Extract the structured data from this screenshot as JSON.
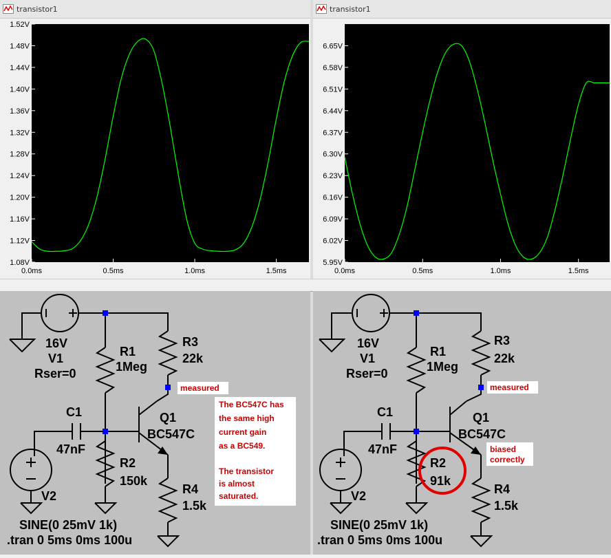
{
  "plots": [
    {
      "window_title": "transistor1",
      "chart_data": {
        "type": "line",
        "x": [
          0.0,
          0.05,
          0.1,
          0.15,
          0.2,
          0.25,
          0.3,
          0.35,
          0.4,
          0.45,
          0.5,
          0.55,
          0.6,
          0.65,
          0.7,
          0.75,
          0.8,
          0.85,
          0.9,
          0.95,
          1.0,
          1.05,
          1.1,
          1.15,
          1.2,
          1.25,
          1.3,
          1.35,
          1.4,
          1.45,
          1.5,
          1.55,
          1.6,
          1.65,
          1.7
        ],
        "y": [
          1.118,
          1.104,
          1.1,
          1.1,
          1.101,
          1.105,
          1.12,
          1.15,
          1.2,
          1.27,
          1.35,
          1.42,
          1.465,
          1.488,
          1.492,
          1.47,
          1.41,
          1.33,
          1.24,
          1.16,
          1.115,
          1.104,
          1.101,
          1.1,
          1.1,
          1.103,
          1.115,
          1.145,
          1.195,
          1.265,
          1.345,
          1.415,
          1.462,
          1.486,
          1.488
        ],
        "xlim": [
          0.0,
          1.7
        ],
        "ylim": [
          1.08,
          1.52
        ],
        "grid": false,
        "yticks": [
          "1.08V",
          "1.12V",
          "1.16V",
          "1.20V",
          "1.24V",
          "1.28V",
          "1.32V",
          "1.36V",
          "1.40V",
          "1.44V",
          "1.48V",
          "1.52V"
        ],
        "xticks": [
          "0.0ms",
          "0.5ms",
          "1.0ms",
          "1.5ms"
        ],
        "trace_color": "#00ff00"
      }
    },
    {
      "window_title": "transistor1",
      "chart_data": {
        "type": "line",
        "x": [
          0.0,
          0.05,
          0.1,
          0.15,
          0.2,
          0.25,
          0.3,
          0.35,
          0.4,
          0.45,
          0.5,
          0.55,
          0.6,
          0.65,
          0.7,
          0.75,
          0.8,
          0.85,
          0.9,
          0.95,
          1.0,
          1.05,
          1.1,
          1.15,
          1.2,
          1.25,
          1.3,
          1.35,
          1.4,
          1.45,
          1.5,
          1.55,
          1.6,
          1.65,
          1.7
        ],
        "y": [
          6.29,
          6.17,
          6.07,
          6.0,
          5.965,
          5.96,
          5.98,
          6.04,
          6.13,
          6.25,
          6.37,
          6.48,
          6.57,
          6.63,
          6.655,
          6.65,
          6.6,
          6.51,
          6.4,
          6.28,
          6.17,
          6.07,
          6.0,
          5.965,
          5.96,
          5.98,
          6.03,
          6.12,
          6.23,
          6.35,
          6.46,
          6.53,
          6.53,
          6.53,
          6.53
        ],
        "xlim": [
          0.0,
          1.7
        ],
        "ylim": [
          5.95,
          6.72
        ],
        "grid": false,
        "yticks": [
          "5.95V",
          "6.02V",
          "6.09V",
          "6.16V",
          "6.23V",
          "6.30V",
          "6.37V",
          "6.44V",
          "6.51V",
          "6.58V",
          "6.65V"
        ],
        "xticks": [
          "0.0ms",
          "0.5ms",
          "1.0ms",
          "1.5ms"
        ],
        "trace_color": "#00ff00"
      }
    }
  ],
  "schematics": [
    {
      "v1": {
        "value": "16V",
        "name": "V1",
        "param": "Rser=0"
      },
      "r1": {
        "name": "R1",
        "value": "1Meg"
      },
      "r3": {
        "name": "R3",
        "value": "22k"
      },
      "c1": {
        "name": "C1",
        "value": "47nF"
      },
      "q1": {
        "name": "Q1",
        "model": "BC547C"
      },
      "r2": {
        "name": "R2",
        "value": "150k"
      },
      "r4": {
        "name": "R4",
        "value": "1.5k"
      },
      "v2": {
        "name": "V2",
        "source": "SINE(0 25mV 1k)"
      },
      "sim": ".tran 0 5ms 0ms 100u",
      "measured_label": "measured",
      "note": [
        "The BC547C has",
        "the same high",
        "current gain",
        "as a BC549.",
        "",
        "The transistor",
        "is almost",
        "saturated."
      ]
    },
    {
      "v1": {
        "value": "16V",
        "name": "V1",
        "param": "Rser=0"
      },
      "r1": {
        "name": "R1",
        "value": "1Meg"
      },
      "r3": {
        "name": "R3",
        "value": "22k"
      },
      "c1": {
        "name": "C1",
        "value": "47nF"
      },
      "q1": {
        "name": "Q1",
        "model": "BC547C"
      },
      "r2": {
        "name": "R2",
        "value": "91k"
      },
      "r4": {
        "name": "R4",
        "value": "1.5k"
      },
      "v2": {
        "name": "V2",
        "source": "SINE(0 25mV 1k)"
      },
      "sim": ".tran 0 5ms 0ms 100u",
      "measured_label": "measured",
      "note": [
        "biased",
        "correctly"
      ]
    }
  ],
  "colors": {
    "wire": "#0000ff",
    "annotation": "#cc0000",
    "highlight": "#e00000"
  }
}
